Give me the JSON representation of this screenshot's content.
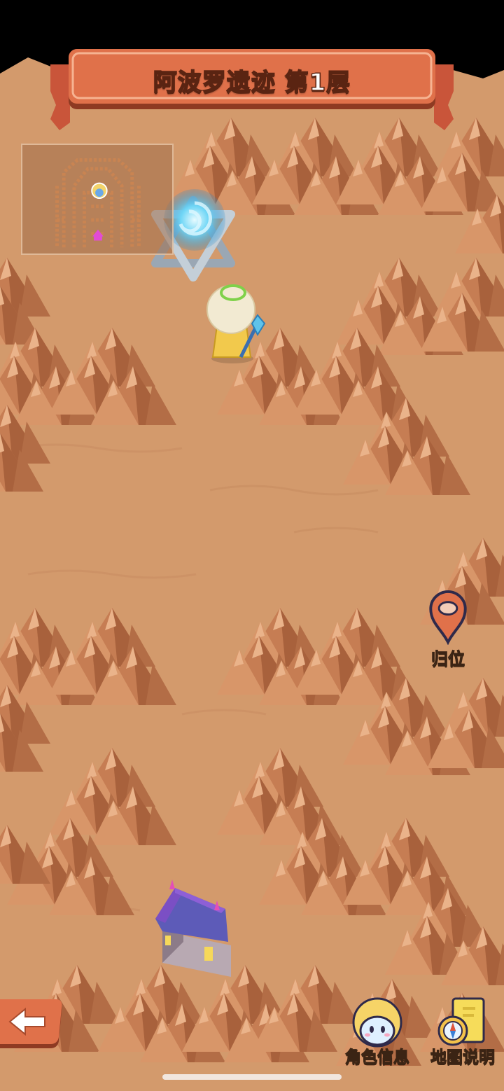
{
  "header": {
    "title": "阿波罗遗迹 第1层"
  },
  "controls": {
    "recenter_label": "归位",
    "character_info_label": "角色信息",
    "map_guide_label": "地图说明"
  },
  "icons": {
    "back": "back-arrow-icon",
    "recenter": "location-pin-icon",
    "character": "character-portrait-icon",
    "map": "map-scroll-compass-icon"
  },
  "colors": {
    "ground": "#d39a6c",
    "banner": "#e0714a",
    "banner_dark": "#a84a2c",
    "portal": "#57c8f0",
    "house_roof": "#7b4fc4",
    "minimap_marker": "#e24bd6"
  }
}
